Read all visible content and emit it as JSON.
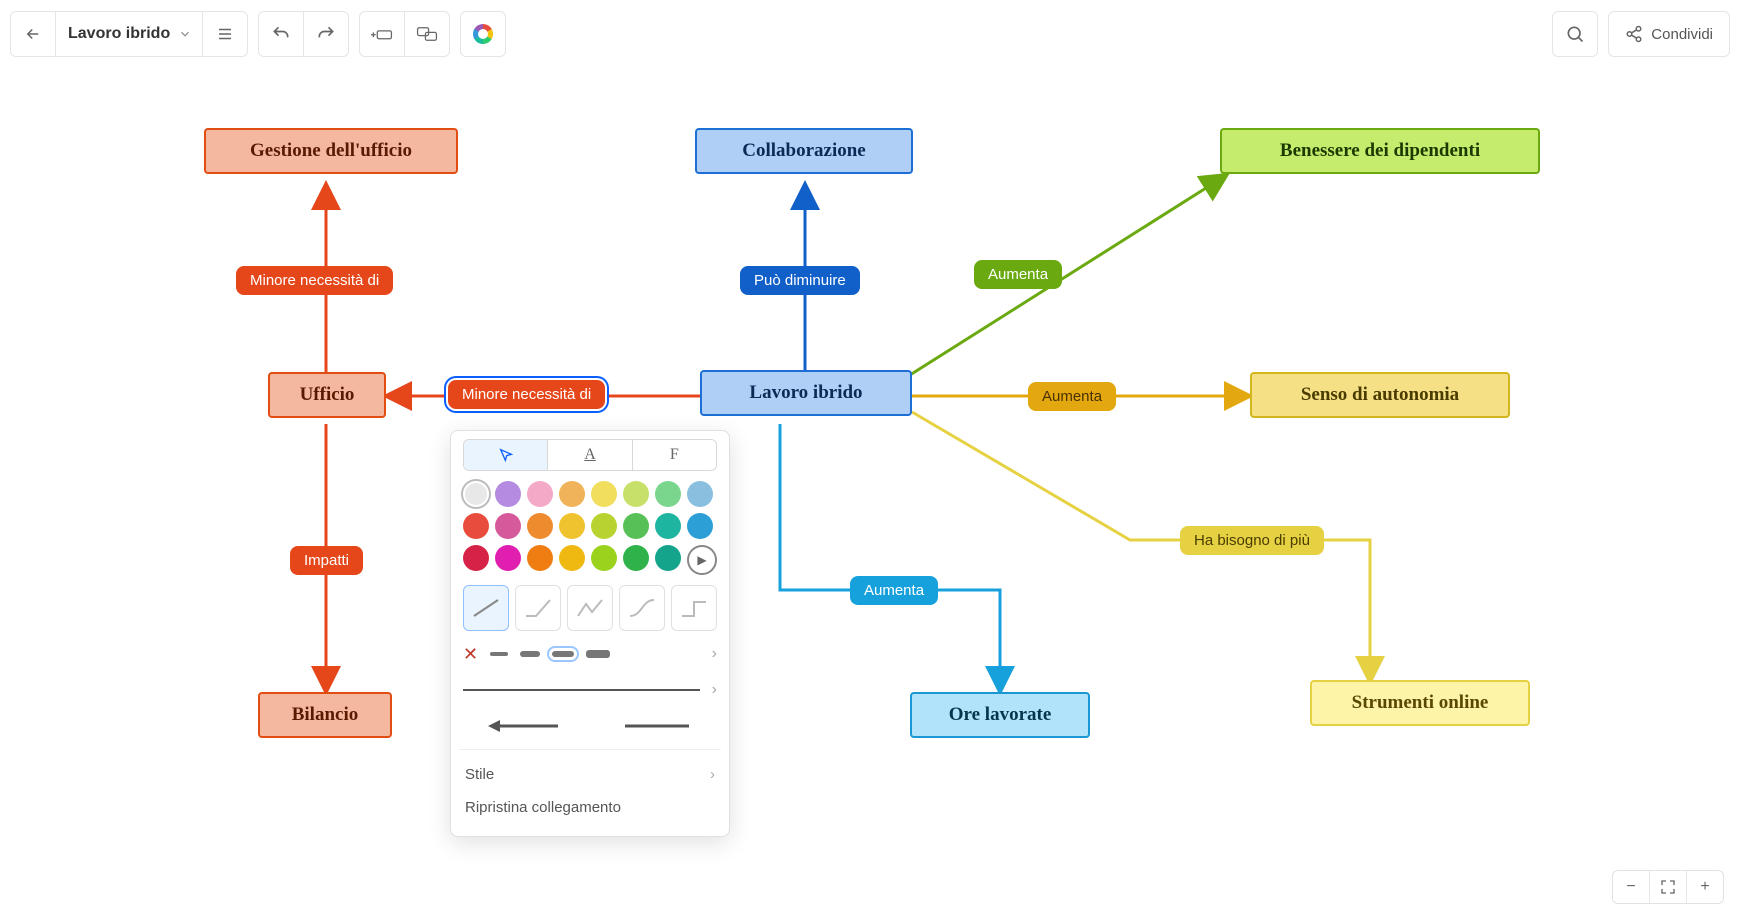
{
  "header": {
    "doc_title": "Lavoro ibrido",
    "share_label": "Condividi"
  },
  "nodes": {
    "center": "Lavoro ibrido",
    "office_mgmt": "Gestione dell'ufficio",
    "office": "Ufficio",
    "budget": "Bilancio",
    "collab": "Collaborazione",
    "wellbeing": "Benessere dei dipendenti",
    "autonomy": "Senso di autonomia",
    "tools": "Strumenti online",
    "hours": "Ore lavorate"
  },
  "edges": {
    "less_need_1": "Minore necessità di",
    "less_need_2": "Minore necessità di",
    "impacts": "Impatti",
    "can_decrease": "Può diminuire",
    "increases_1": "Aumenta",
    "increases_2": "Aumenta",
    "increases_3": "Aumenta",
    "needs_more": "Ha bisogno di più"
  },
  "popover": {
    "style_label": "Stile",
    "reset_label": "Ripristina collegamento",
    "letter_tab": "A",
    "font_tab": "F"
  },
  "colors": {
    "orange": "#e5471a",
    "blue": "#1160c9",
    "green": "#6aa90f",
    "mustard": "#e3a80f",
    "yellow": "#e5d142",
    "cyan": "#17a1dc"
  },
  "swatches_row1": [
    "#e8e8e8",
    "#b48be0",
    "#f4a9c7",
    "#f0b35a",
    "#f1de5c",
    "#c6e06a",
    "#79d68c",
    "#8bbfe0"
  ],
  "swatches_row2": [
    "#e74c3c",
    "#d65a9b",
    "#ef8b2f",
    "#efc22f",
    "#b8d22f",
    "#57c057",
    "#1eb5a0",
    "#2c9fd6"
  ],
  "swatches_row3": [
    "#d62246",
    "#e01eb0",
    "#f07d12",
    "#f0b912",
    "#9ad21e",
    "#30b24a",
    "#14a38b",
    "play"
  ]
}
